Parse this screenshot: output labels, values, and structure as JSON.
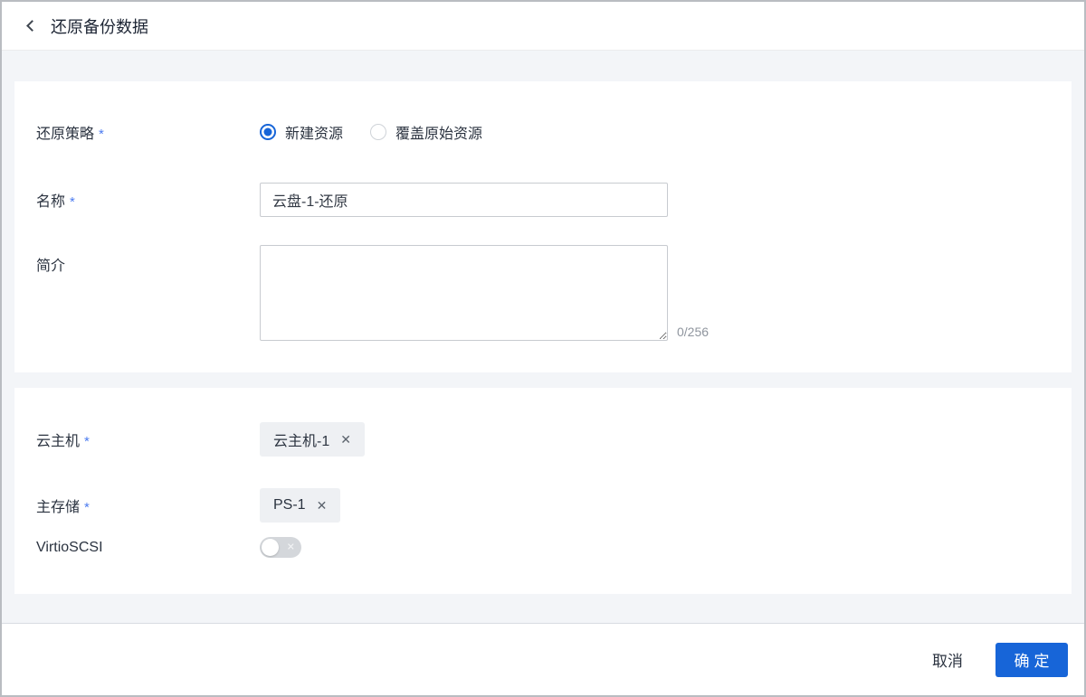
{
  "header": {
    "title": "还原备份数据"
  },
  "icons": {
    "back": "chevron-left",
    "remove": "✕",
    "toggle_off": "✕"
  },
  "form": {
    "restore_strategy": {
      "label": "还原策略",
      "required": "*",
      "options": [
        {
          "label": "新建资源",
          "selected": true
        },
        {
          "label": "覆盖原始资源",
          "selected": false
        }
      ]
    },
    "name": {
      "label": "名称",
      "required": "*",
      "value": "云盘-1-还原"
    },
    "description": {
      "label": "简介",
      "value": "",
      "counter": "0/256"
    },
    "vm": {
      "label": "云主机",
      "required": "*",
      "tag": "云主机-1"
    },
    "primary_storage": {
      "label": "主存储",
      "required": "*",
      "tag": "PS-1"
    },
    "virtio_scsi": {
      "label": "VirtioSCSI",
      "state": "off"
    }
  },
  "footer": {
    "cancel_label": "取消",
    "confirm_label": "确定"
  },
  "colors": {
    "accent_blue": "#1765d8",
    "required_mark": "#4d7cf0",
    "body_background": "#f3f5f8",
    "tag_background": "#eef0f3"
  }
}
